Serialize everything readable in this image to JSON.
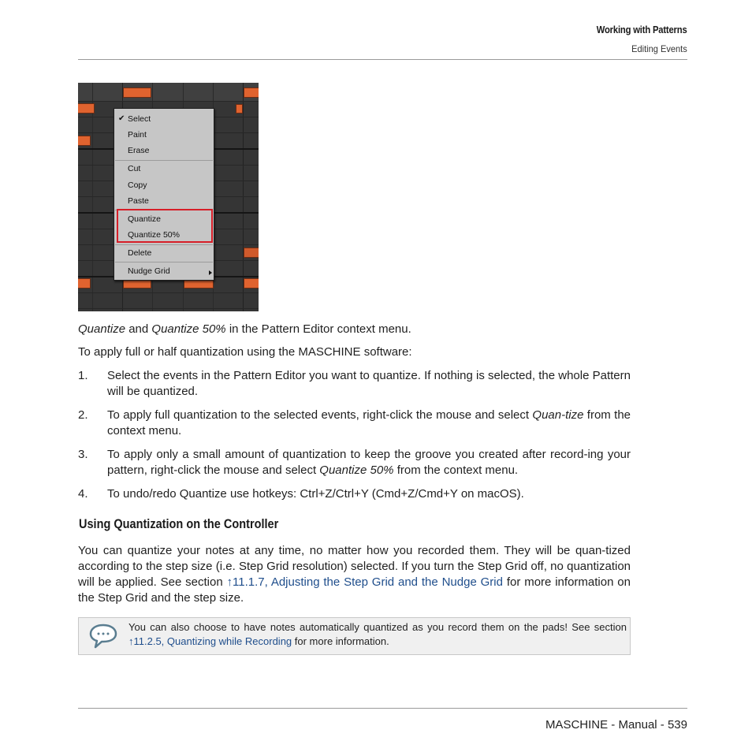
{
  "header": {
    "chapter": "Working with Patterns",
    "section": "Editing Events"
  },
  "figure": {
    "description": "Pattern Editor context menu screenshot",
    "colors": {
      "background": "#353535",
      "event": "#e0632f",
      "menu": "#c6c6c6",
      "highlight_box": "#d71e28"
    },
    "context_menu": {
      "checked_item": "Select",
      "groups": [
        [
          "Select",
          "Paint",
          "Erase"
        ],
        [
          "Cut",
          "Copy",
          "Paste"
        ],
        [
          "Quantize",
          "Quantize 50%"
        ],
        [
          "Delete"
        ],
        [
          "Nudge Grid"
        ]
      ],
      "items": {
        "select": "Select",
        "paint": "Paint",
        "erase": "Erase",
        "cut": "Cut",
        "copy": "Copy",
        "paste": "Paste",
        "quantize": "Quantize",
        "quantize50": "Quantize 50%",
        "delete": "Delete",
        "nudge_grid": "Nudge Grid"
      },
      "highlighted": [
        "Quantize",
        "Quantize 50%"
      ],
      "submenu_items": [
        "Nudge Grid"
      ]
    }
  },
  "caption": {
    "part1": "Quantize",
    "part2": " and ",
    "part3": "Quantize 50%",
    "part4": " in the Pattern Editor context menu."
  },
  "intro": "To apply full or half quantization using the MASCHINE software:",
  "steps": [
    {
      "num": "1.",
      "text": "Select the events in the Pattern Editor you want to quantize. If nothing is selected, the whole Pattern will be quantized."
    },
    {
      "num": "2.",
      "pre": "To apply full quantization to the selected events, right-click the mouse and select ",
      "em": "Quan-tize",
      "post": " from the context menu."
    },
    {
      "num": "3.",
      "pre": "To apply only a small amount of quantization to keep the groove you created after record-ing your pattern, right-click the mouse and select ",
      "em": "Quantize 50%",
      "post": " from the context menu."
    },
    {
      "num": "4.",
      "text": "To undo/redo Quantize use hotkeys: Ctrl+Z/Ctrl+Y (Cmd+Z/Cmd+Y on macOS)."
    }
  ],
  "subsection": {
    "title": "Using Quantization on the Controller",
    "para_pre": "You can quantize your notes at any time, no matter how you recorded them. They will be quan-tized according to the step size (i.e. Step Grid resolution) selected. If you turn the Step Grid off, no quantization will be applied. See section ",
    "link": "↑11.1.7, Adjusting the Step Grid and the Nudge Grid",
    "para_post": " for more information on the Step Grid and the step size."
  },
  "note": {
    "icon": "speech-bubble-icon",
    "pre": "You can also choose to have notes automatically quantized as you record them on the pads! See section ",
    "link": "↑11.2.5, Quantizing while Recording",
    "post": " for more information."
  },
  "footer": {
    "text": "MASCHINE - Manual - 539"
  },
  "colors": {
    "link": "#1f4e8c",
    "rule": "#9a9a9a",
    "note_bg": "#f0f0f0"
  }
}
